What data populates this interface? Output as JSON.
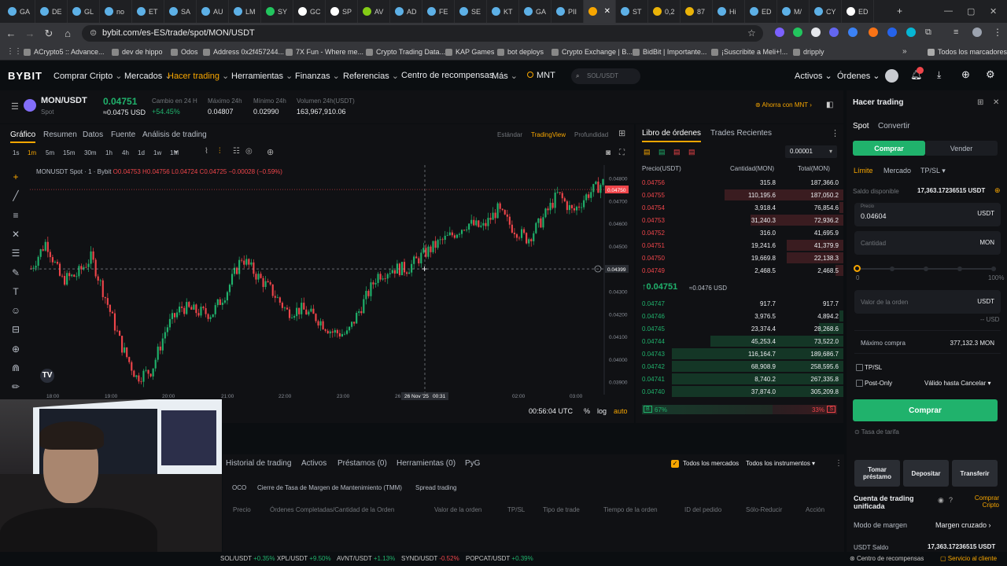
{
  "browser": {
    "tabs": [
      "GA",
      "DE",
      "GL",
      "no",
      "ET",
      "SA",
      "AU",
      "LM",
      "SY",
      "GC",
      "SP",
      "AV",
      "AD",
      "FE",
      "SE",
      "KT",
      "GA",
      "PII",
      "",
      "ST",
      "0,2",
      "87",
      "Hi",
      "ED",
      "M/",
      "CY",
      "ED"
    ],
    "url": "bybit.com/es-ES/trade/spot/MON/USDT",
    "bookmarks": [
      "ACrypto5 :: Advance...",
      "dev de hippo",
      "Odos",
      "Address 0x2f457244...",
      "7X Fun - Where me...",
      "Crypto Trading Data...",
      "KAP Games",
      "bot deploys",
      "Crypto Exchange | B...",
      "BidBit | Importante...",
      "¡Suscribite a Meli+!...",
      "dripply"
    ],
    "all_bookmarks": "Todos los marcadores"
  },
  "header": {
    "logo": "BYBIT",
    "menu": [
      "Comprar Cripto",
      "Mercados",
      "Hacer trading",
      "Herramientas",
      "Finanzas",
      "Referencias",
      "Centro de recompensas",
      "Más",
      "MNT"
    ],
    "search_placeholder": "SOL/USDT",
    "right": [
      "Activos",
      "Órdenes"
    ],
    "accent": "#f7a600"
  },
  "ticker": {
    "pair": "MON/USDT",
    "type": "Spot",
    "price": "0.04751",
    "price_usd": "≈0.0475 USD",
    "stats": [
      {
        "label": "Cambio en 24 H",
        "value": "+54.45%"
      },
      {
        "label": "Máximo 24h",
        "value": "0.04807"
      },
      {
        "label": "Mínimo 24h",
        "value": "0.02990"
      },
      {
        "label": "Volumen 24h(USDT)",
        "value": "163,967,910.06"
      }
    ],
    "promo": "Ahorra con MNT"
  },
  "chart": {
    "tabs": [
      "Gráfico",
      "Resumen",
      "Datos",
      "Fuente",
      "Análisis de trading"
    ],
    "views": [
      "Estándar",
      "TradingView",
      "Profundidad"
    ],
    "intervals": [
      "1s",
      "1m",
      "5m",
      "15m",
      "30m",
      "1h",
      "4h",
      "1d",
      "1w",
      "1M"
    ],
    "legend": "MONUSDT Spot · 1 · Bybit",
    "ohlc": "O0.04753 H0.04756 L0.04724 C0.04725 −0.00028 (−0.59%)",
    "price_ticks": [
      "0.04800",
      "0.04700",
      "0.04600",
      "0.04500",
      "0.04400",
      "0.04300",
      "0.04200",
      "0.04100",
      "0.04000",
      "0.03900"
    ],
    "last_price_tag": "0.04750",
    "crosshair_price": "0.04399",
    "time_ticks": [
      "18:00",
      "19:00",
      "20:00",
      "21:00",
      "22:00",
      "23:00",
      "26",
      "02:00",
      "03:00"
    ],
    "crosshair_time": "26 Nov '25",
    "crosshair_clock": "00:31",
    "clock": "00:56:04 UTC",
    "scale_opts": [
      "%",
      "log",
      "auto"
    ]
  },
  "orderbook": {
    "tabs": [
      "Libro de órdenes",
      "Trades Recientes"
    ],
    "precision": "0.00001",
    "headers": [
      "Precio(USDT)",
      "Cantidad(MON)",
      "Total(MON)"
    ],
    "asks": [
      {
        "p": "0.04756",
        "q": "315.8",
        "t": "187,366.0",
        "w": 0.0
      },
      {
        "p": "0.04755",
        "q": "110,195.6",
        "t": "187,050.2",
        "w": 0.59
      },
      {
        "p": "0.04754",
        "q": "3,918.4",
        "t": "76,854.6",
        "w": 0.02
      },
      {
        "p": "0.04753",
        "q": "31,240.3",
        "t": "72,936.2",
        "w": 0.46
      },
      {
        "p": "0.04752",
        "q": "316.0",
        "t": "41,695.9",
        "w": 0.0
      },
      {
        "p": "0.04751",
        "q": "19,241.6",
        "t": "41,379.9",
        "w": 0.28
      },
      {
        "p": "0.04750",
        "q": "19,669.8",
        "t": "22,138.3",
        "w": 0.28
      },
      {
        "p": "0.04749",
        "q": "2,468.5",
        "t": "2,468.5",
        "w": 0.04
      }
    ],
    "mid_price": "0.04751",
    "mid_usd": "≈0.0476 USD",
    "bids": [
      {
        "p": "0.04747",
        "q": "917.7",
        "t": "917.7",
        "w": 0.0
      },
      {
        "p": "0.04746",
        "q": "3,976.5",
        "t": "4,894.2",
        "w": 0.02
      },
      {
        "p": "0.04745",
        "q": "23,374.4",
        "t": "28,268.6",
        "w": 0.12
      },
      {
        "p": "0.04744",
        "q": "45,253.4",
        "t": "73,522.0",
        "w": 0.66
      },
      {
        "p": "0.04743",
        "q": "116,164.7",
        "t": "189,686.7",
        "w": 0.85
      },
      {
        "p": "0.04742",
        "q": "68,908.9",
        "t": "258,595.6",
        "w": 0.85
      },
      {
        "p": "0.04741",
        "q": "8,740.2",
        "t": "267,335.8",
        "w": 0.85
      },
      {
        "p": "0.04740",
        "q": "37,874.0",
        "t": "305,209.8",
        "w": 0.85
      }
    ],
    "buy_pct": "67%",
    "sell_pct": "33%",
    "buy_tag": "B",
    "sell_tag": "S"
  },
  "trade": {
    "title": "Hacer trading",
    "tabs": [
      "Spot",
      "Convertir"
    ],
    "buy": "Comprar",
    "sell": "Vender",
    "order_types": [
      "Límite",
      "Mercado",
      "TP/SL"
    ],
    "balance_label": "Saldo disponible",
    "balance": "17,363.17236515 USDT",
    "price_label": "Precio",
    "price_value": "0.04604",
    "price_unit": "USDT",
    "qty_label": "Cantidad",
    "qty_unit": "MON",
    "slider": [
      "0",
      "100%"
    ],
    "order_value_label": "Valor de la orden",
    "order_value_unit": "USDT",
    "order_value_hint": "-- USD",
    "max_label": "Máximo compra",
    "max_value": "377,132.3 MON",
    "tpsl": "TP/SL",
    "postonly": "Post-Only",
    "tif": "Válido hasta Cancelar",
    "submit": "Comprar",
    "fee": "Tasa de tarifa",
    "actions": [
      "Tomar préstamo",
      "Depositar",
      "Transferir"
    ],
    "account": "Cuenta de trading unificada",
    "buy_crypto": "Comprar Cripto",
    "margin_label": "Modo de margen",
    "margin_value": "Margen cruzado",
    "usdt_label": "USDT Saldo",
    "usdt_value": "17,363.17236515 USDT"
  },
  "bottom": {
    "tabs": [
      "Historial de trading",
      "Activos",
      "Préstamos (0)",
      "Herramientas (0)",
      "PyG"
    ],
    "filters": [
      "Todos los mercados",
      "Todos los instrumentos"
    ],
    "subtabs": [
      "OCO",
      "Cierre de Tasa de Margen de Mantenimiento (TMM)",
      "Spread trading"
    ],
    "columns": [
      "Precio",
      "Órdenes Completadas/Cantidad de la Orden",
      "Valor de la orden",
      "TP/SL",
      "Tipo de trade",
      "Tiempo de la orden",
      "ID del pedido",
      "Sólo-Reducir",
      "Acción"
    ]
  },
  "footer": {
    "tickers": [
      {
        "n": "SOL/USDT",
        "c": "+0.35%"
      },
      {
        "n": "XPL/USDT",
        "c": "+9.50%"
      },
      {
        "n": "AVNT/USDT",
        "c": "+1.13%"
      },
      {
        "n": "SYND/USDT",
        "c": "-0.52%"
      },
      {
        "n": "POPCAT/USDT",
        "c": "+0.39%"
      }
    ],
    "right": [
      "Centro de recompensas",
      "Servicio al cliente"
    ]
  },
  "colors": {
    "up": "#20b26c",
    "down": "#ef454a",
    "accent": "#f7a600",
    "buy_btn": "#20b26c"
  }
}
